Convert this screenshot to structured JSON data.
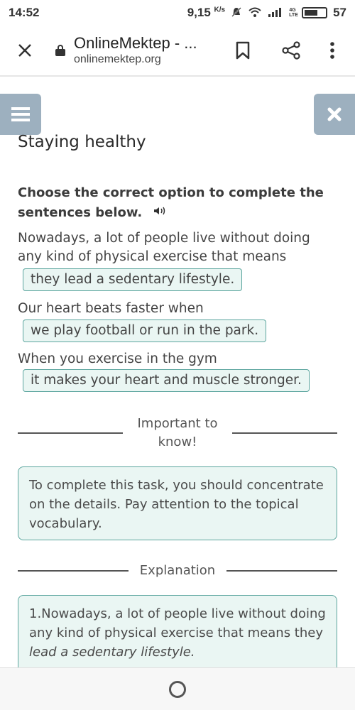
{
  "status_bar": {
    "time": "14:52",
    "speed": "9,15",
    "speed_unit": "K/s",
    "network_type_top": "4G",
    "network_type_bottom": "LTE",
    "battery": "57"
  },
  "browser": {
    "title": "OnlineMektep - ...",
    "url": "onlinemektep.org"
  },
  "page": {
    "heading": "Staying healthy",
    "task": "Choose the correct option to complete the sentences below.",
    "sentences": [
      {
        "text": "Nowadays, a lot of people live without doing any kind of physical exercise that means",
        "answer": "they lead a sedentary lifestyle."
      },
      {
        "text": "Our heart beats faster when",
        "answer": "we play football or run in the park."
      },
      {
        "text": "When you exercise in the gym",
        "answer": "it makes your heart and muscle stronger."
      }
    ],
    "important_label": "Important to know!",
    "important_text": "To complete this task, you should concentrate on the details. Pay attention to the topical vocabulary.",
    "explanation_label": "Explanation",
    "explanation_prefix": "1.Nowadays, a lot of people live without doing any kind of physical exercise that means they ",
    "explanation_italic": "lead a sedentary lifestyle."
  },
  "colors": {
    "accent_border": "#5ba59e",
    "accent_bg": "#eaf6f3",
    "side_button": "#9db0bf"
  }
}
